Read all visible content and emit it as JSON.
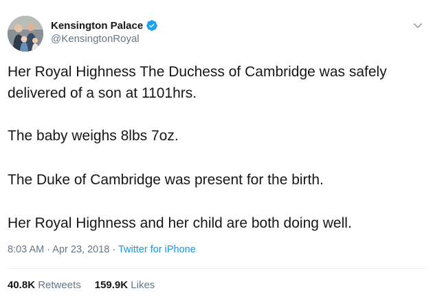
{
  "account": {
    "display_name": "Kensington Palace",
    "handle": "@KensingtonRoyal",
    "verified": true
  },
  "tweet": {
    "lines": [
      "Her Royal Highness The Duchess of Cambridge was safely",
      "delivered of a son at 1101hrs.",
      "The baby weighs 8lbs 7oz.",
      "The Duke of Cambridge was present for the birth.",
      "Her Royal Highness and her child are both doing well."
    ],
    "time": "8:03 AM",
    "date": "Apr 23, 2018",
    "source": "Twitter for iPhone",
    "separator": " · "
  },
  "stats": {
    "retweets_count": "40.8K",
    "retweets_label": "Retweets",
    "likes_count": "159.9K",
    "likes_label": "Likes"
  },
  "icons": {
    "verified": "verified-badge-icon",
    "caret": "chevron-down-icon"
  },
  "colors": {
    "text": "#14171a",
    "secondary": "#657786",
    "link": "#1b95e0",
    "verified": "#1da1f2",
    "divider": "#e6ecf0"
  }
}
